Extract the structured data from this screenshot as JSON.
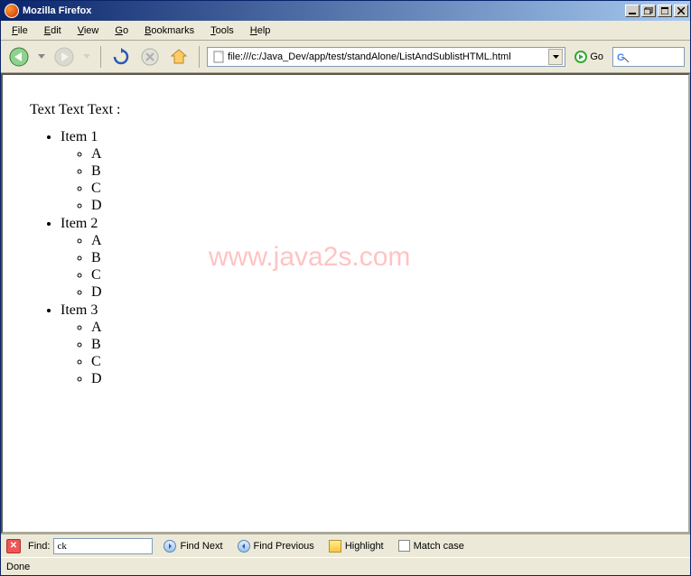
{
  "titlebar": {
    "text": "Mozilla Firefox"
  },
  "menubar": {
    "items": [
      {
        "label": "File",
        "accel": "F"
      },
      {
        "label": "Edit",
        "accel": "E"
      },
      {
        "label": "View",
        "accel": "V"
      },
      {
        "label": "Go",
        "accel": "G"
      },
      {
        "label": "Bookmarks",
        "accel": "B"
      },
      {
        "label": "Tools",
        "accel": "T"
      },
      {
        "label": "Help",
        "accel": "H"
      }
    ]
  },
  "toolbar": {
    "addressbar_value": "file:///c:/Java_Dev/app/test/standAlone/ListAndSublistHTML.html",
    "go_label": "Go"
  },
  "page": {
    "intro": "Text Text Text :",
    "items": [
      {
        "label": "Item 1",
        "sub": [
          "A",
          "B",
          "C",
          "D"
        ]
      },
      {
        "label": "Item 2",
        "sub": [
          "A",
          "B",
          "C",
          "D"
        ]
      },
      {
        "label": "Item 3",
        "sub": [
          "A",
          "B",
          "C",
          "D"
        ]
      }
    ],
    "watermark": "www.java2s.com"
  },
  "findbar": {
    "find_label": "Find:",
    "find_value": "ck",
    "find_next": "Find Next",
    "find_prev": "Find Previous",
    "highlight": "Highlight",
    "match_case": "Match case"
  },
  "statusbar": {
    "text": "Done"
  }
}
